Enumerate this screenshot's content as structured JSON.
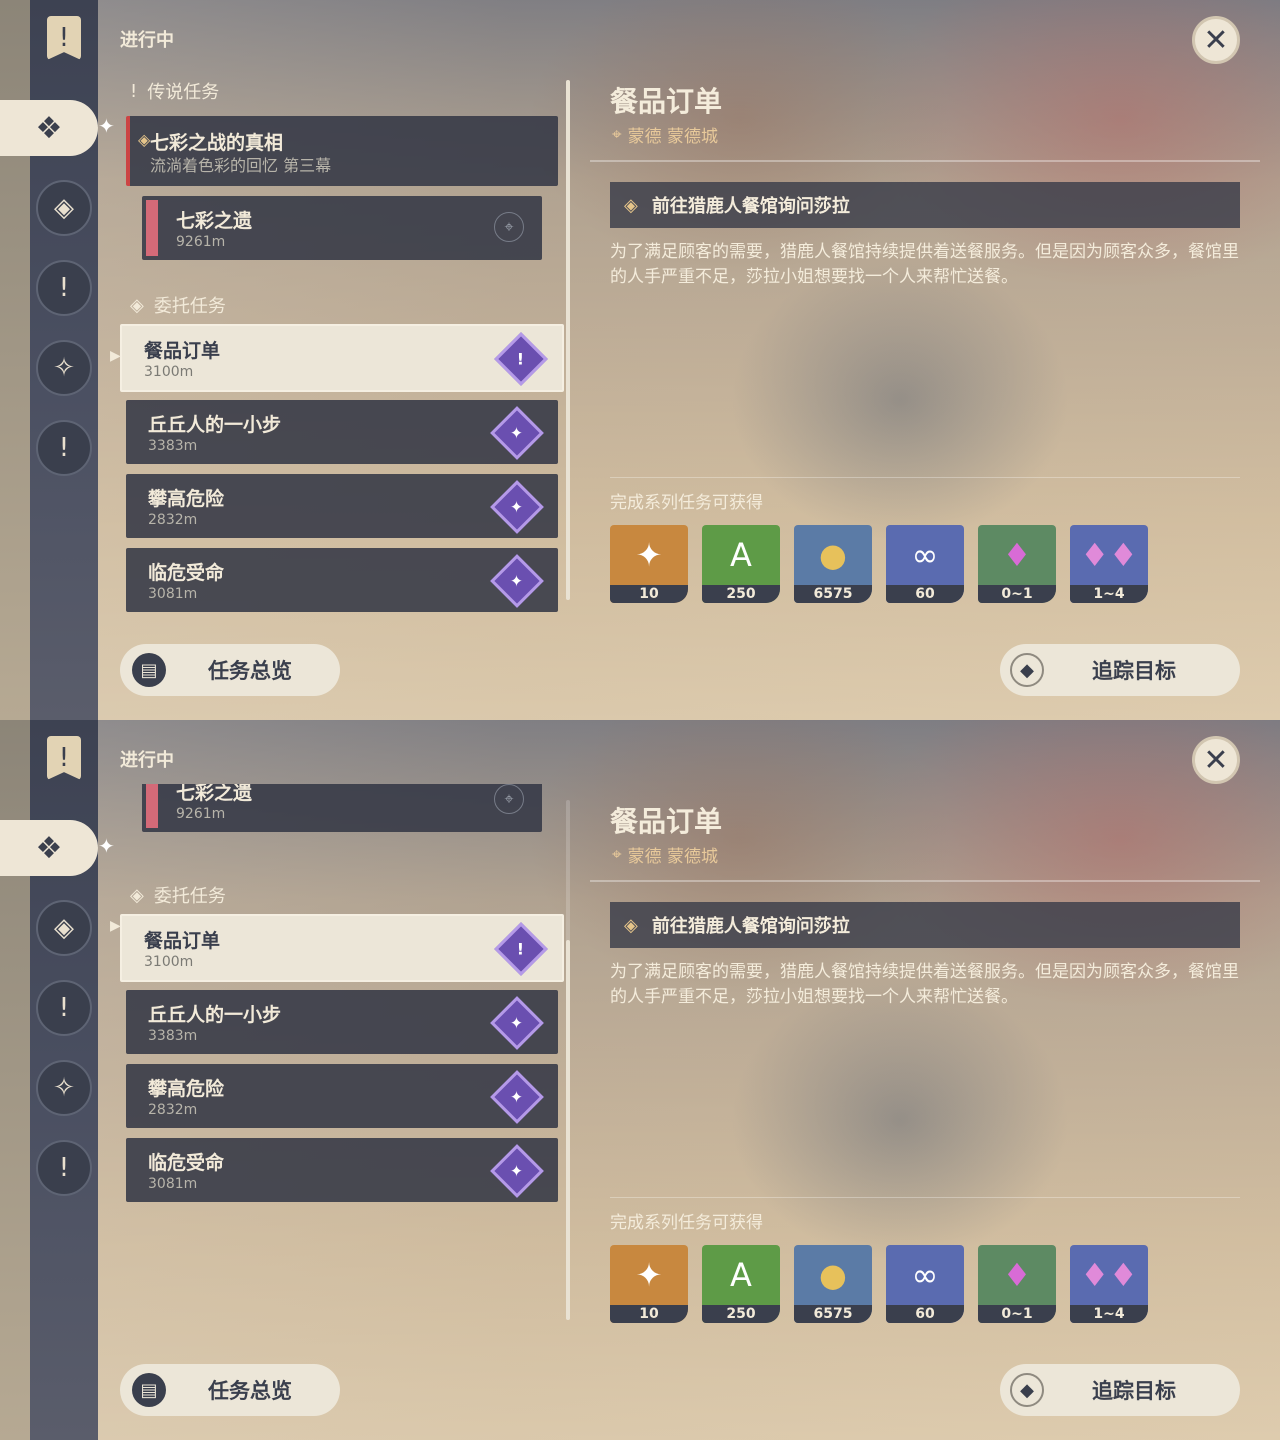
{
  "header": {
    "in_progress": "进行中"
  },
  "nav": {
    "bookmark_icon": "quest-banner-icon",
    "close_symbol": "✕"
  },
  "categories": {
    "legend": "传说任务",
    "commission": "委托任务"
  },
  "legend_quest": {
    "title": "七彩之战的真相",
    "subtitle": "流淌着色彩的回忆 第三幕"
  },
  "sub_quest": {
    "title": "七彩之遗",
    "distance": "9261m"
  },
  "quests": [
    {
      "title": "餐品订单",
      "distance": "3100m"
    },
    {
      "title": "丘丘人的一小步",
      "distance": "3383m"
    },
    {
      "title": "攀高危险",
      "distance": "2832m"
    },
    {
      "title": "临危受命",
      "distance": "3081m"
    }
  ],
  "detail": {
    "title": "餐品订单",
    "location": "蒙德 蒙德城",
    "objective": "前往猎鹿人餐馆询问莎拉",
    "description": "为了满足顾客的需要，猎鹿人餐馆持续提供着送餐服务。但是因为顾客众多，餐馆里的人手严重不足，莎拉小姐想要找一个人来帮忙送餐。",
    "rewards_label": "完成系列任务可获得",
    "rewards": [
      {
        "amount": "10",
        "icon": "primogem-icon",
        "color": "#c8883f"
      },
      {
        "amount": "250",
        "icon": "adventure-exp-icon",
        "color": "#5e9b47"
      },
      {
        "amount": "6575",
        "icon": "mora-icon",
        "color": "#5b7ba6"
      },
      {
        "amount": "60",
        "icon": "companionship-exp-icon",
        "color": "#5a6bb0"
      },
      {
        "amount": "0~1",
        "icon": "crystal-icon",
        "color": "#5d8a63"
      },
      {
        "amount": "1~4",
        "icon": "crystal-cluster-icon",
        "color": "#5a6bb0"
      }
    ]
  },
  "buttons": {
    "overview": "任务总览",
    "track": "追踪目标"
  }
}
